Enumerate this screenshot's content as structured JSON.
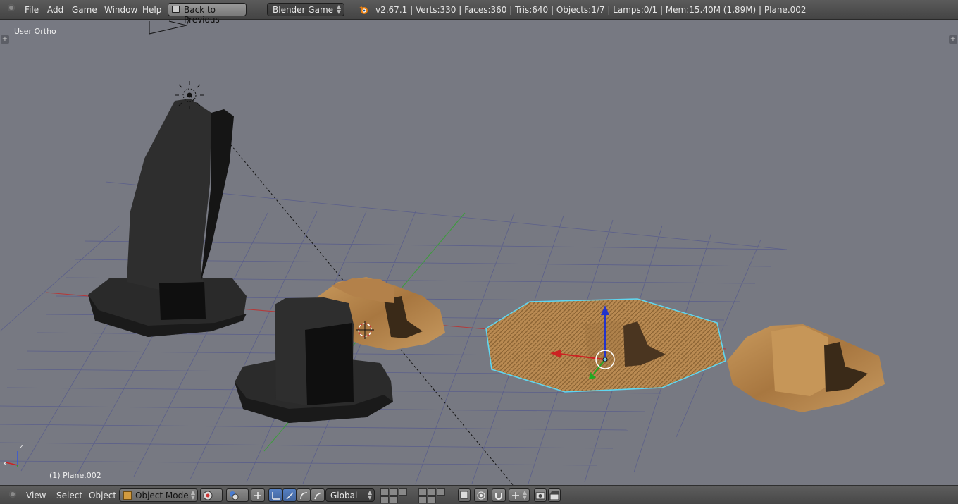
{
  "top_header": {
    "menu": [
      "File",
      "Add",
      "Game",
      "Window",
      "Help"
    ],
    "back_button": "Back to Previous",
    "engine": "Blender Game",
    "stats": "v2.67.1 | Verts:330 | Faces:360 | Tris:640 | Objects:1/7 | Lamps:0/1 | Mem:15.40M (1.89M) | Plane.002"
  },
  "viewport": {
    "view_name": "User Ortho",
    "active_object": "(1) Plane.002",
    "axis_labels": {
      "x": "x",
      "z": "z"
    }
  },
  "bottom_header": {
    "menu": [
      "View",
      "Select",
      "Object"
    ],
    "mode": "Object Mode",
    "orientation": "Global"
  },
  "colors": {
    "viewport_bg": "#777982",
    "grid": "#5b5f8a",
    "x_axis": "#b33a3a",
    "y_axis": "#3f9a3f",
    "selection_outline": "#5fd6f0",
    "wood": "#b4824a",
    "dark_mesh": "#1e1e1e"
  },
  "icons": [
    "blender-logo-icon",
    "lamp-icon",
    "camera-icon",
    "3d-cursor-icon",
    "manipulator-icon",
    "axis-gizmo-icon"
  ]
}
